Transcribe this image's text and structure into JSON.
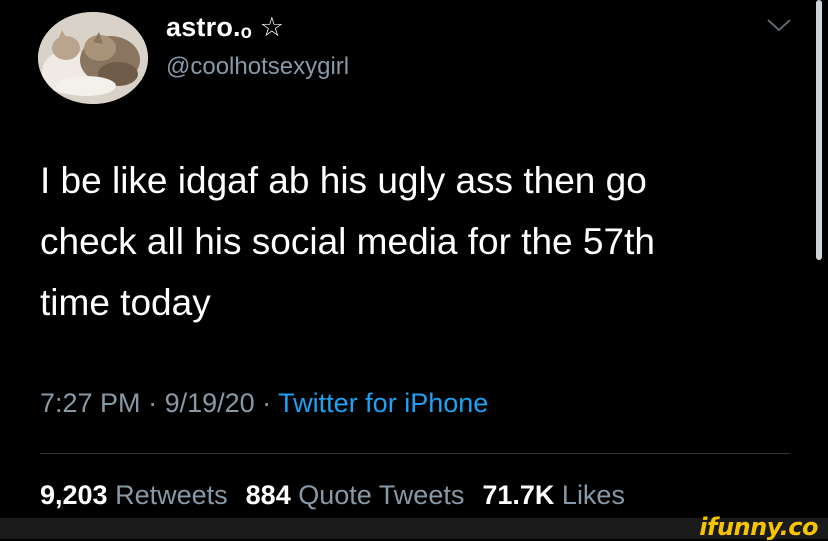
{
  "tweet": {
    "display_name": "astro.ₒ ☆",
    "handle": "@coolhotsexygirl",
    "body_lines": [
      "I be like idgaf ab his ugly ass then go",
      "check all his social media for the 57th",
      "time today"
    ],
    "meta": {
      "time": "7:27 PM",
      "separator": " · ",
      "date": "9/19/20",
      "source": "Twitter for iPhone"
    },
    "stats": {
      "retweets_count": "9,203",
      "retweets_label": "Retweets",
      "quotes_count": "884",
      "quotes_label": "Quote Tweets",
      "likes_count": "71.7K",
      "likes_label": "Likes"
    }
  },
  "watermark": "ifunny.co",
  "icons": {
    "avatar": "avatar-image-cats",
    "menu": "chevron-down-icon"
  },
  "colors": {
    "background": "#000000",
    "primary_text": "#ffffff",
    "secondary_text": "#8899a6",
    "link": "#1da1f2",
    "watermark": "#f6c400"
  }
}
